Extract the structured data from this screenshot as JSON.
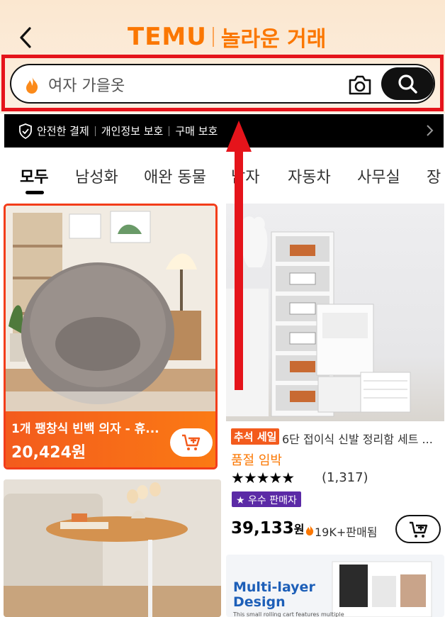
{
  "header": {
    "logo": "TEMU",
    "tagline": "놀라운 거래",
    "back_icon": "chevron-left-icon"
  },
  "search": {
    "value": "여자 가을옷",
    "icon": "flame-icon",
    "camera_icon": "camera-icon",
    "button_icon": "search-icon"
  },
  "trust_bar": {
    "items": [
      "안전한 결제",
      "개인정보 보호",
      "구매 보호"
    ]
  },
  "tabs": [
    "모두",
    "남성화",
    "애완 동물",
    "남자",
    "자동차",
    "사무실",
    "장"
  ],
  "products": [
    {
      "title": "1개 팽창식 빈백 의자 - 휴...",
      "price": "20,424원"
    },
    {
      "badge": "추석 세일",
      "title": "6단 접이식 신발 정리함 세트 ...",
      "stock": "품절 임박",
      "stars": "★★★★★",
      "rating_count": "(1,317)",
      "seller": "우수 판매자",
      "price_num": "39,133",
      "price_unit": "원",
      "sold": "19K+판매됨"
    },
    {
      "image_title_1": "Multi-layer",
      "image_title_2": "Design",
      "image_caption": "This small rolling cart features multiple"
    }
  ],
  "colors": {
    "accent": "#fb7701",
    "highlight": "#e5141b",
    "seller_badge": "#5b2aa6"
  }
}
